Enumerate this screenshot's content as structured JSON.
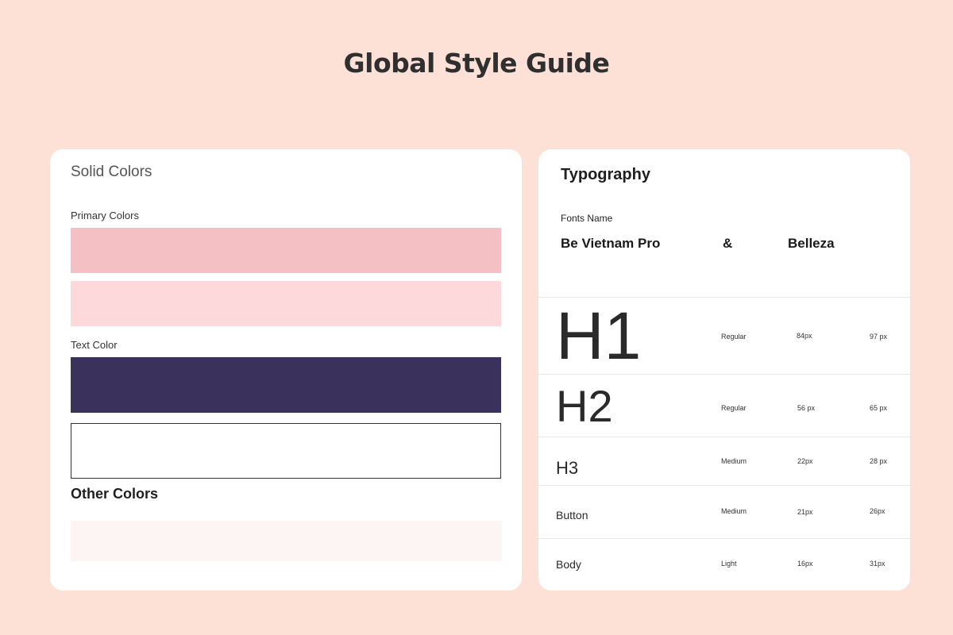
{
  "page": {
    "title": "Global Style Guide"
  },
  "colors_card": {
    "heading": "Solid Colors",
    "primary_label": "Primary Colors",
    "text_label": "Text Color",
    "other_label": "Other Colors",
    "swatches": {
      "primary_1": "#f5c0c3",
      "primary_2": "#fed9dc",
      "text_1": "#3a325c",
      "text_2": "#ffffff",
      "other_1": "#fcf5f4"
    }
  },
  "typography_card": {
    "heading": "Typography",
    "fonts_name_label": "Fonts Name",
    "font_primary": "Be Vietnam Pro",
    "ampersand": "&",
    "font_secondary": "Belleza",
    "rows": [
      {
        "sample": "H1",
        "weight": "Regular",
        "size": "84px",
        "line_height": "97 px"
      },
      {
        "sample": "H2",
        "weight": "Regular",
        "size": "56 px",
        "line_height": "65 px"
      },
      {
        "sample": "H3",
        "weight": "Medium",
        "size": "22px",
        "line_height": "28 px"
      },
      {
        "sample": "Button",
        "weight": "Medium",
        "size": "21px",
        "line_height": "26px"
      },
      {
        "sample": "Body",
        "weight": "Light",
        "size": "16px",
        "line_height": "31px"
      }
    ]
  }
}
